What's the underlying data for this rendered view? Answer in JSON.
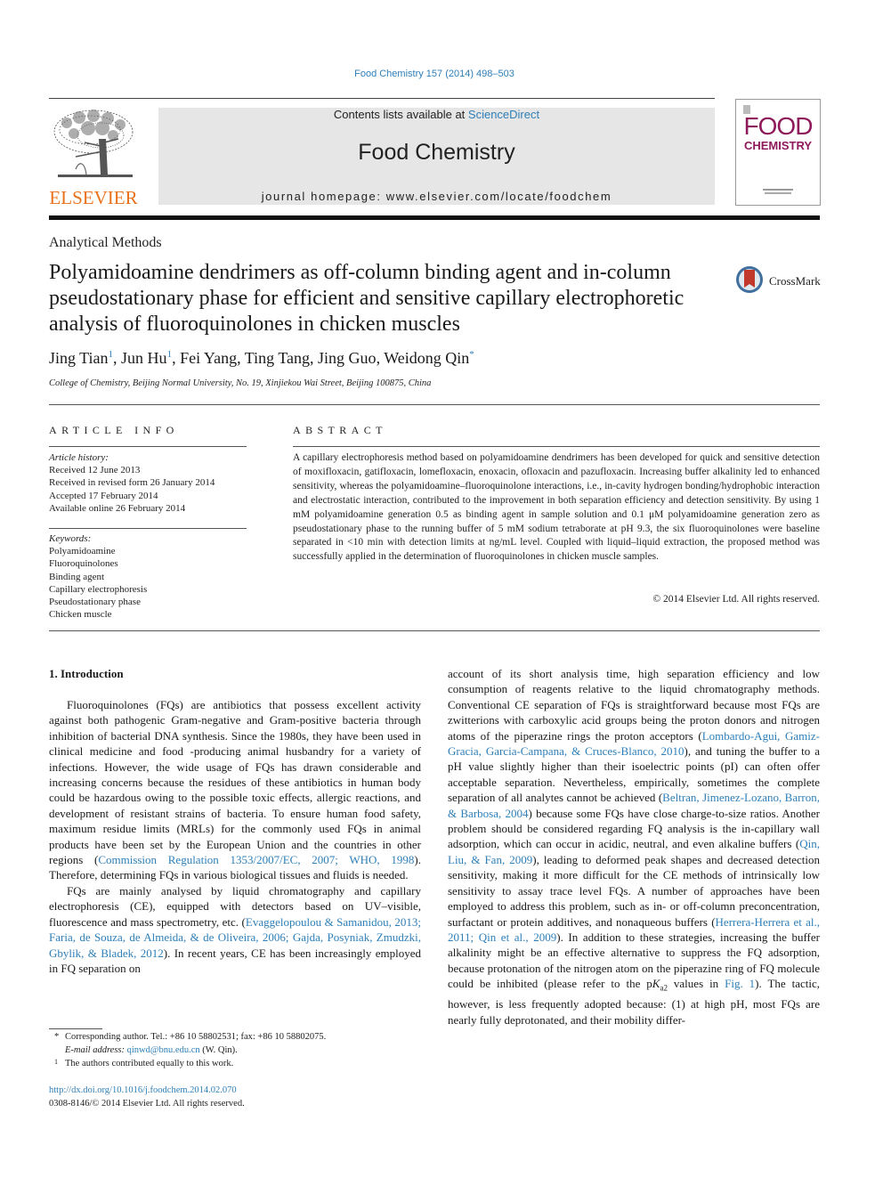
{
  "header": {
    "journal_reference": "Food Chemistry 157 (2014) 498–503",
    "contents_prefix": "Contents lists available at ",
    "contents_link": "ScienceDirect",
    "journal_title": "Food Chemistry",
    "homepage": "journal homepage: www.elsevier.com/locate/foodchem",
    "publisher_logo_text": "ELSEVIER",
    "cover_line1": "FOOD",
    "cover_line2": "CHEMISTRY",
    "crossmark_label": "CrossMark",
    "colors": {
      "link": "#2e7fb8",
      "elsevier_orange": "#e9711c",
      "cover_magenta": "#8e1a5c",
      "masthead_bg": "#e6e6e6"
    }
  },
  "article": {
    "section": "Analytical Methods",
    "title": "Polyamidoamine dendrimers as off-column binding agent and in-column pseudostationary phase for efficient and sensitive capillary electrophoretic analysis of fluoroquinolones in chicken muscles",
    "authors": [
      {
        "name": "Jing Tian",
        "mark": "1"
      },
      {
        "name": "Jun Hu",
        "mark": "1"
      },
      {
        "name": "Fei Yang",
        "mark": ""
      },
      {
        "name": "Ting Tang",
        "mark": ""
      },
      {
        "name": "Jing Guo",
        "mark": ""
      },
      {
        "name": "Weidong Qin",
        "mark": "*"
      }
    ],
    "affiliation": "College of Chemistry, Beijing Normal University, No. 19, Xinjiekou Wai Street, Beijing 100875, China"
  },
  "article_info": {
    "heading": "ARTICLE INFO",
    "history_label": "Article history:",
    "history": [
      "Received 12 June 2013",
      "Received in revised form 26 January 2014",
      "Accepted 17 February 2014",
      "Available online 26 February 2014"
    ],
    "keywords_label": "Keywords:",
    "keywords": [
      "Polyamidoamine",
      "Fluoroquinolones",
      "Binding agent",
      "Capillary electrophoresis",
      "Pseudostationary phase",
      "Chicken muscle"
    ]
  },
  "abstract": {
    "heading": "ABSTRACT",
    "text": "A capillary electrophoresis method based on polyamidoamine dendrimers has been developed for quick and sensitive detection of moxifloxacin, gatifloxacin, lomefloxacin, enoxacin, ofloxacin and pazufloxacin. Increasing buffer alkalinity led to enhanced sensitivity, whereas the polyamidoamine–fluoroquinolone interactions, i.e., in-cavity hydrogen bonding/hydrophobic interaction and electrostatic interaction, contributed to the improvement in both separation efficiency and detection sensitivity. By using 1 mM polyamidoamine generation 0.5 as binding agent in sample solution and 0.1 μM polyamidoamine generation zero as pseudostationary phase to the running buffer of 5 mM sodium tetraborate at pH 9.3, the six fluoroquinolones were baseline separated in <10 min with detection limits at ng/mL level. Coupled with liquid–liquid extraction, the proposed method was successfully applied in the determination of fluoroquinolones in chicken muscle samples.",
    "copyright": "© 2014 Elsevier Ltd. All rights reserved."
  },
  "introduction": {
    "heading": "1. Introduction",
    "left_p1_a": "Fluoroquinolones (FQs) are antibiotics that possess excellent activity against both pathogenic Gram-negative and Gram-positive bacteria through inhibition of bacterial DNA synthesis. Since the 1980s, they have been used in clinical medicine and food -producing animal husbandry for a variety of infections. However, the wide usage of FQs has drawn considerable and increasing concerns because the residues of these antibiotics in human body could be hazardous owing to the possible toxic effects, allergic reactions, and development of resistant strains of bacteria. To ensure human food safety, maximum residue limits (MRLs) for the commonly used FQs in animal products have been set by the European Union and the countries in other regions (",
    "left_p1_cite": "Commission Regulation 1353/2007/EC, 2007; WHO, 1998",
    "left_p1_b": "). Therefore, determining FQs in various biological tissues and fluids is needed.",
    "left_p2_a": "FQs are mainly analysed by liquid chromatography and capillary electrophoresis (CE), equipped with detectors based on UV–visible, fluorescence and mass spectrometry, etc. (",
    "left_p2_cite": "Evaggelopoulou & Samanidou, 2013; Faria, de Souza, de Almeida, & de Oliveira, 2006; Gajda, Posyniak, Zmudzki, Gbylik, & Bladek, 2012",
    "left_p2_b": "). In recent years, CE has been increasingly employed in FQ separation on",
    "right_a": "account of its short analysis time, high separation efficiency and low consumption of reagents relative to the liquid chromatography methods. Conventional CE separation of FQs is straightforward because most FQs are zwitterions with carboxylic acid groups being the proton donors and nitrogen atoms of the piperazine rings the proton acceptors (",
    "right_cite1": "Lombardo-Agui, Gamiz-Gracia, Garcia-Campana, & Cruces-Blanco, 2010",
    "right_b": "), and tuning the buffer to a pH value slightly higher than their isoelectric points (pI) can often offer acceptable separation. Nevertheless, empirically, sometimes the complete separation of all analytes cannot be achieved (",
    "right_cite2": "Beltran, Jimenez-Lozano, Barron, & Barbosa, 2004",
    "right_c": ") because some FQs have close charge-to-size ratios. Another problem should be considered regarding FQ analysis is the in-capillary wall adsorption, which can occur in acidic, neutral, and even alkaline buffers (",
    "right_cite3": "Qin, Liu, & Fan, 2009",
    "right_d": "), leading to deformed peak shapes and decreased detection sensitivity, making it more difficult for the CE methods of intrinsically low sensitivity to assay trace level FQs. A number of approaches have been employed to address this problem, such as in- or off-column preconcentration, surfactant or protein additives, and nonaqueous buffers (",
    "right_cite4": "Herrera-Herrera et al., 2011; Qin et al., 2009",
    "right_e": "). In addition to these strategies, increasing the buffer alkalinity might be an effective alternative to suppress the FQ adsorption, because protonation of the nitrogen atom on the piperazine ring of FQ molecule could be inhibited (please refer to the p",
    "right_pka_k": "K",
    "right_pka_sub": "a2",
    "right_f": " values in ",
    "right_cite5": "Fig. 1",
    "right_g": "). The tactic, however, is less frequently adopted because: (1) at high pH, most FQs are nearly fully deprotonated, and their mobility differ-"
  },
  "footnotes": {
    "corresponding_mark": "*",
    "corresponding": "Corresponding author. Tel.: +86 10 58802531; fax: +86 10 58802075.",
    "email_label": "E-mail address:",
    "email": "qinwd@bnu.edu.cn",
    "email_suffix": " (W. Qin).",
    "equal_mark": "1",
    "equal": "The authors contributed equally to this work.",
    "doi": "http://dx.doi.org/10.1016/j.foodchem.2014.02.070",
    "issn": "0308-8146/© 2014 Elsevier Ltd. All rights reserved."
  }
}
